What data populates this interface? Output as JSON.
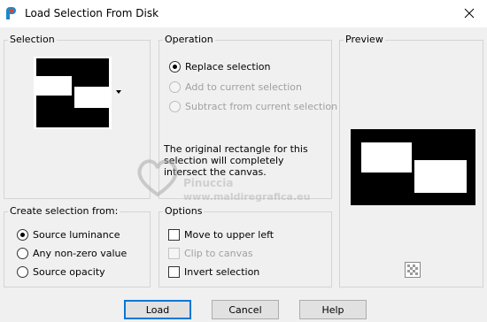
{
  "window": {
    "title": "Load Selection From Disk"
  },
  "selection": {
    "label": "Selection",
    "dropdown_value": "selection mask thumbnail"
  },
  "operation": {
    "label": "Operation",
    "options": [
      {
        "label": "Replace selection",
        "selected": true,
        "enabled": true
      },
      {
        "label": "Add to current selection",
        "selected": false,
        "enabled": false
      },
      {
        "label": "Subtract from current selection",
        "selected": false,
        "enabled": false
      }
    ],
    "info": "The original rectangle for this selection will completely intersect the canvas."
  },
  "preview": {
    "label": "Preview"
  },
  "create_from": {
    "label": "Create selection from:",
    "options": [
      {
        "label": "Source luminance",
        "selected": true
      },
      {
        "label": "Any non-zero value",
        "selected": false
      },
      {
        "label": "Source opacity",
        "selected": false
      }
    ]
  },
  "options": {
    "label": "Options",
    "items": [
      {
        "label": "Move to upper left",
        "checked": false,
        "enabled": true
      },
      {
        "label": "Clip to canvas",
        "checked": false,
        "enabled": false
      },
      {
        "label": "Invert selection",
        "checked": false,
        "enabled": true
      }
    ]
  },
  "buttons": {
    "load": "Load",
    "cancel": "Cancel",
    "help": "Help"
  },
  "watermark": {
    "name": "Pinuccia",
    "site": "www.maldiregrafica.eu"
  },
  "colors": {
    "accent": "#0078d7",
    "group_border": "#d4d4d4",
    "background": "#f0f0f0"
  }
}
